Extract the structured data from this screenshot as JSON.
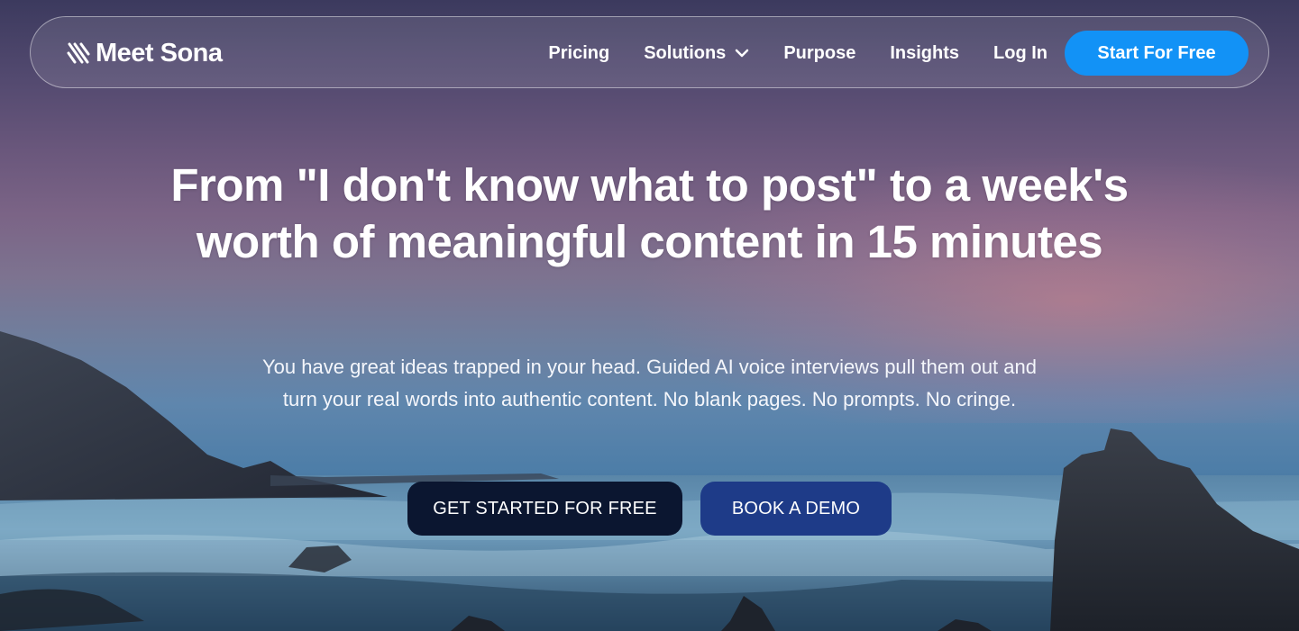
{
  "brand": {
    "name": "Meet Sona",
    "logo_icon": "stripes-logo-icon"
  },
  "nav": {
    "links": [
      {
        "label": "Pricing"
      },
      {
        "label": "Solutions",
        "icon": "chevron-down-icon"
      },
      {
        "label": "Purpose"
      },
      {
        "label": "Insights"
      },
      {
        "label": "Log In"
      }
    ],
    "cta_label": "Start For Free"
  },
  "hero": {
    "headline": "From \"I don't know what to post\" to a week's worth of meaningful content in 15 minutes",
    "subheadline": "You have great ideas trapped in your head. Guided AI voice interviews pull them out and turn your real words into authentic content. No blank pages. No prompts. No cringe.",
    "primary_button": "GET STARTED FOR FREE",
    "secondary_button": "BOOK A DEMO"
  },
  "colors": {
    "accent": "#1292f6",
    "primary_button": "#0b1630",
    "secondary_button": "#1e3b88"
  }
}
